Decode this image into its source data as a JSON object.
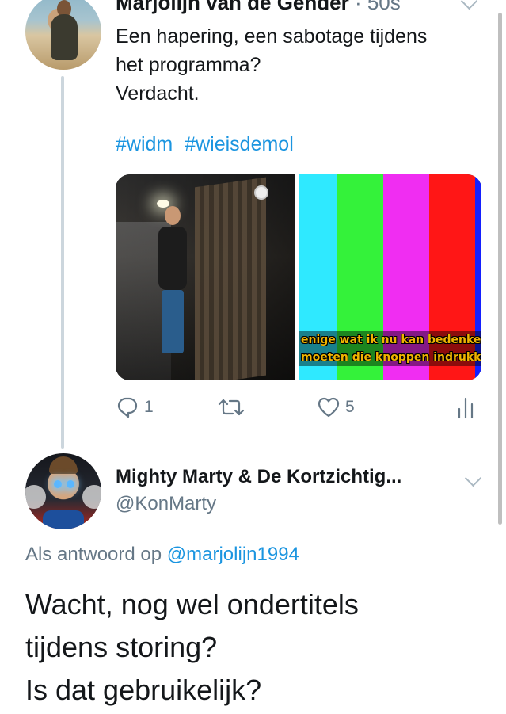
{
  "tweet1": {
    "author_name": "Marjolijn van de Gender",
    "time": "· 50s",
    "lines": [
      "Een hapering, een sabotage tijdens",
      "het programma?",
      "Verdacht."
    ],
    "hashtags": [
      "#widm",
      "#wieisdemol"
    ],
    "media": {
      "subtitle_lines": [
        "enige wat ik nu kan bedenken i",
        "moeten die knoppen indrukken"
      ],
      "test_bar_colors": [
        "#2fe9ff",
        "#34f23a",
        "#f02df2",
        "#ff1616",
        "#1420ff"
      ]
    },
    "actions": {
      "reply_icon": "reply-icon",
      "reply_count": "1",
      "retweet_icon": "retweet-icon",
      "like_icon": "heart-icon",
      "like_count": "5",
      "stats_icon": "stats-icon"
    }
  },
  "tweet2": {
    "author_name": "Mighty Marty & De Kortzichtig...",
    "handle": "@KonMarty",
    "reply_prefix": "Als antwoord op",
    "reply_mention": "@marjolijn1994",
    "lines": [
      "Wacht, nog wel ondertitels",
      "tijdens storing?",
      "Is dat gebruikelijk?"
    ]
  },
  "colors": {
    "link": "#1b95e0",
    "secondary_text": "#657786",
    "thread_line": "#ccd6dd"
  }
}
